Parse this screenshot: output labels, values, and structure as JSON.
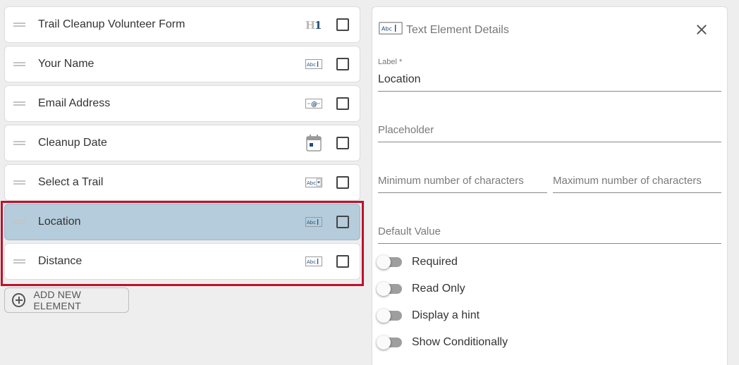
{
  "form_elements": [
    {
      "label": "Trail Cleanup Volunteer Form",
      "icon": "heading-h1-icon",
      "icon_text": "H1",
      "selected": false
    },
    {
      "label": "Your Name",
      "icon": "text-field-icon",
      "icon_text": "Abc",
      "selected": false
    },
    {
      "label": "Email Address",
      "icon": "email-field-icon",
      "icon_text": "@",
      "selected": false
    },
    {
      "label": "Cleanup Date",
      "icon": "calendar-icon",
      "icon_text": "",
      "selected": false
    },
    {
      "label": "Select a Trail",
      "icon": "dropdown-field-icon",
      "icon_text": "Abc",
      "selected": false
    },
    {
      "label": "Location",
      "icon": "text-field-icon",
      "icon_text": "Abc",
      "selected": true
    },
    {
      "label": "Distance",
      "icon": "text-field-icon",
      "icon_text": "Abc",
      "selected": false
    }
  ],
  "add_button": {
    "label": "ADD NEW ELEMENT",
    "icon": "add-circle-icon"
  },
  "details_panel": {
    "title": "Text Element Details",
    "title_icon": "text-field-icon",
    "title_icon_text": "Abc",
    "close_icon": "close-icon",
    "label_field": {
      "label": "Label *",
      "value": "Location"
    },
    "placeholder_field": {
      "placeholder": "Placeholder"
    },
    "min_chars_field": {
      "placeholder": "Minimum number of characters"
    },
    "max_chars_field": {
      "placeholder": "Maximum number of characters"
    },
    "default_value_field": {
      "placeholder": "Default Value"
    },
    "toggles": [
      {
        "label": "Required",
        "on": false
      },
      {
        "label": "Read Only",
        "on": false
      },
      {
        "label": "Display a hint",
        "on": false
      },
      {
        "label": "Show Conditionally",
        "on": false
      }
    ]
  },
  "colors": {
    "selected_row": "#b4ccdb",
    "selection_frame": "#c0102a",
    "icon_blue": "#1f4e79",
    "toggle_track": "#9e9e9e"
  }
}
